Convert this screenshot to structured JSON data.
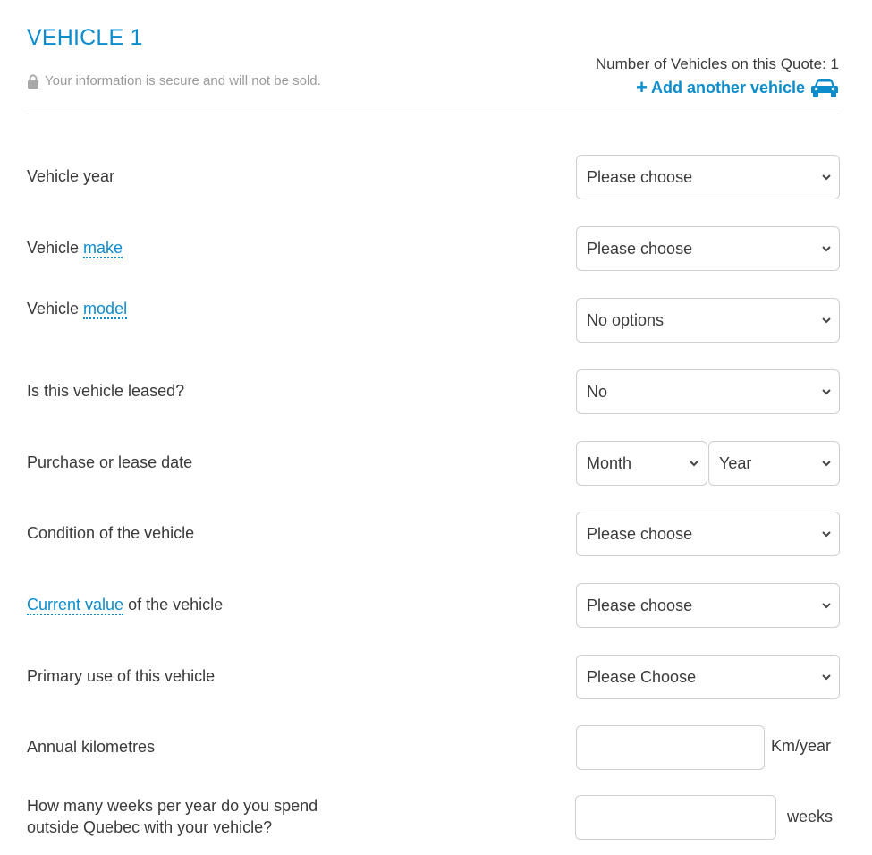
{
  "header": {
    "title": "VEHICLE 1",
    "secure_text": "Your information is secure and will not be sold.",
    "vehicle_count_text": "Number of Vehicles on this Quote: 1",
    "add_vehicle_label": "Add another vehicle",
    "add_icon": "plus-icon",
    "car_icon": "car-icon"
  },
  "fields": {
    "year": {
      "label": "Vehicle year",
      "value": "Please choose"
    },
    "make": {
      "label_prefix": "Vehicle ",
      "label_link": "make",
      "value": "Please choose"
    },
    "model": {
      "label_prefix": "Vehicle ",
      "label_link": "model",
      "value": "No options"
    },
    "leased": {
      "label": "Is this vehicle leased?",
      "value": "No"
    },
    "purchase_date": {
      "label": "Purchase or lease date",
      "month_value": "Month",
      "year_value": "Year"
    },
    "condition": {
      "label": "Condition of the vehicle",
      "value": "Please choose"
    },
    "current_value": {
      "label_link": "Current value",
      "label_suffix": " of the vehicle",
      "value": "Please choose"
    },
    "primary_use": {
      "label": "Primary use of this vehicle",
      "value": "Please Choose"
    },
    "kilometres": {
      "label": "Annual kilometres",
      "value": "",
      "unit": "Km/year"
    },
    "weeks_outside": {
      "label_line1": "How many weeks per year do you spend",
      "label_line2": "outside Quebec with your vehicle?",
      "value": "",
      "unit": "weeks"
    }
  },
  "colors": {
    "accent": "#0a8ccd",
    "text": "#3a3a3a",
    "muted": "#9a9a9a",
    "border": "#cfcfcf"
  }
}
